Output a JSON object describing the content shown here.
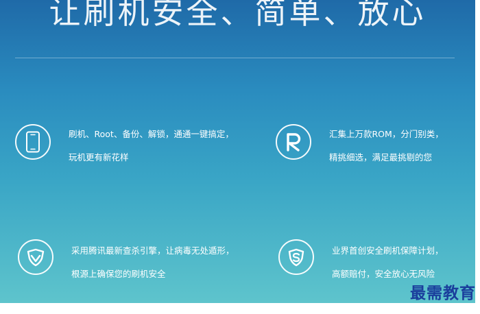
{
  "headline": "让刷机安全、简单、放心",
  "features": [
    {
      "icon": "smartphone-icon",
      "line1": "刷机、Root、备份、解锁，通通一键搞定，",
      "line2": "玩机更有新花样"
    },
    {
      "icon": "rom-r-icon",
      "line1": "汇集上万款ROM，分门别类，",
      "line2": "精挑细选，满足最挑剔的您"
    },
    {
      "icon": "shield-check-icon",
      "line1": "采用腾讯最新查杀引擎，让病毒无处遁形，",
      "line2": "根源上确保您的刷机安全"
    },
    {
      "icon": "shield-s-icon",
      "line1": "业界首创安全刷机保障计划，",
      "line2": "高额赔付，安全放心无风险"
    }
  ],
  "watermark": "最需教育"
}
